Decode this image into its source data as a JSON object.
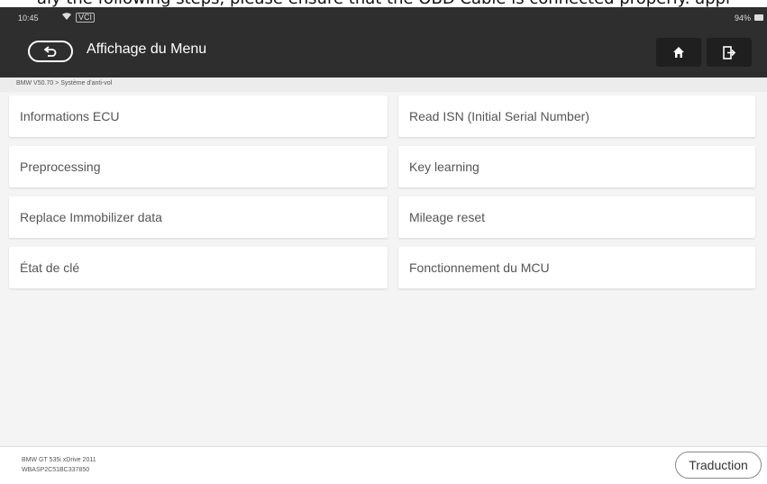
{
  "top_banner": "aly the following steps, please ensure that the OBD Cable is connected properly. appl",
  "status_bar": {
    "time": "10:45",
    "wifi_icon": "wifi-icon",
    "vci_label": "VCI",
    "battery": "94%"
  },
  "header": {
    "back_icon": "back-icon",
    "title": "Affichage du Menu",
    "home_icon": "home-icon",
    "exit_icon": "exit-icon"
  },
  "breadcrumb": "BMW V50.70 > Système d'anti-vol",
  "menu": {
    "left": [
      {
        "label": "Informations ECU"
      },
      {
        "label": "Preprocessing"
      },
      {
        "label": "Replace Immobilizer data"
      },
      {
        "label": "État de clé"
      }
    ],
    "right": [
      {
        "label": "Read ISN (Initial Serial Number)"
      },
      {
        "label": "Key learning"
      },
      {
        "label": "Mileage reset"
      },
      {
        "label": "Fonctionnement du MCU"
      }
    ]
  },
  "footer": {
    "vehicle_line1": "BMW GT 535i xDrive 2011",
    "vehicle_line2": "WBASP2C51BC337850",
    "translate_label": "Traduction"
  }
}
